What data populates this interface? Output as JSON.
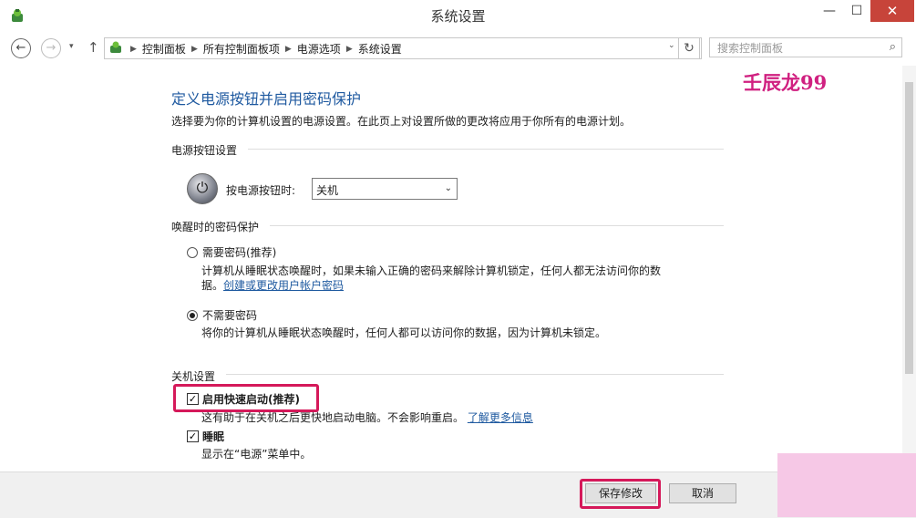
{
  "window": {
    "title": "系统设置",
    "minimize_symbol": "—",
    "maximize_symbol": "☐",
    "close_symbol": "✕"
  },
  "nav": {
    "back_symbol": "←",
    "forward_symbol": "→",
    "recent_symbol": "▾",
    "up_symbol": "↑",
    "breadcrumbs": [
      "控制面板",
      "所有控制面板项",
      "电源选项",
      "系统设置"
    ],
    "dropdown_symbol": "⌄",
    "refresh_symbol": "↻",
    "search_placeholder": "搜索控制面板",
    "search_symbol": "⌕"
  },
  "watermark": "壬辰龙99",
  "content": {
    "heading": "定义电源按钮并启用密码保护",
    "intro": "选择要为你的计算机设置的电源设置。在此页上对设置所做的更改将应用于你所有的电源计划。",
    "power_section": {
      "label": "电源按钮设置",
      "power_button_label": "按电源按钮时:",
      "power_button_value": "关机",
      "power_glyph": "⏻"
    },
    "wake_section": {
      "label": "唤醒时的密码保护",
      "require_password": {
        "label": "需要密码(推荐)",
        "desc_line1": "计算机从睡眠状态唤醒时，如果未输入正确的密码来解除计算机锁定，任何人都无法访问你的数",
        "desc_line2_prefix": "据。",
        "desc_link": "创建或更改用户帐户密码"
      },
      "no_password": {
        "label": "不需要密码",
        "desc": "将你的计算机从睡眠状态唤醒时，任何人都可以访问你的数据，因为计算机未锁定。"
      }
    },
    "shutdown_section": {
      "label": "关机设置",
      "fast_startup": {
        "label": "启用快速启动(推荐)",
        "desc": "这有助于在关机之后更快地启动电脑。不会影响重启。",
        "link": "了解更多信息"
      },
      "sleep": {
        "label": "睡眠",
        "desc": "显示在“电源”菜单中。"
      }
    }
  },
  "footer": {
    "save_label": "保存修改",
    "cancel_label": "取消"
  },
  "colors": {
    "heading": "#1f5aa0",
    "highlight": "#d5195a",
    "watermark": "#d02080"
  }
}
